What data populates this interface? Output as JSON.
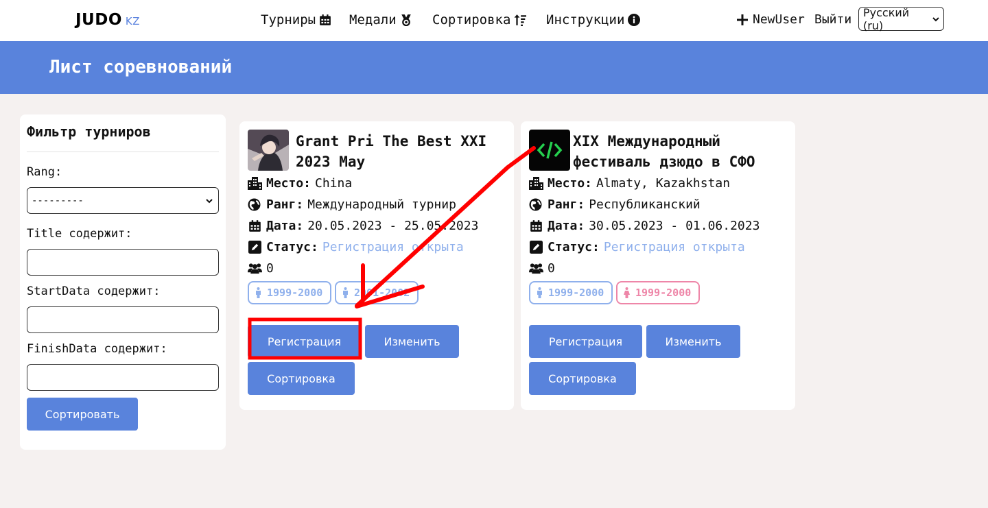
{
  "navbar": {
    "logo": "JUDO",
    "logo_suffix": "KZ",
    "links": [
      {
        "label": "Турниры",
        "icon": "calendar-icon"
      },
      {
        "label": "Медали",
        "icon": "medal-icon"
      },
      {
        "label": "Сортировка",
        "icon": "sort-icon"
      },
      {
        "label": "Инструкции",
        "icon": "info-icon"
      }
    ],
    "user": "NewUser",
    "logout": "Выйти",
    "language": "Русский (ru)"
  },
  "banner": {
    "title": "Лист соревнований"
  },
  "filter": {
    "title": "Фильтр турниров",
    "rang_label": "Rang:",
    "rang_value": "---------",
    "title_label": "Title содержит:",
    "start_label": "StartData содержит:",
    "finish_label": "FinishData содержит:",
    "submit": "Сортировать"
  },
  "labels": {
    "place": "Место:",
    "rank": "Ранг:",
    "date": "Дата:",
    "status": "Статус:"
  },
  "tournaments": [
    {
      "title": "Grant Pri The Best XXI 2023 May",
      "place": "China",
      "rank": "Международный турнир",
      "date": "20.05.2023 - 25.05.2023",
      "status": "Регистрация открыта",
      "participants": "0",
      "categories": [
        {
          "gender": "male",
          "years": "1999-2000"
        },
        {
          "gender": "male",
          "years": "2001-2002"
        }
      ],
      "buttons": {
        "register": "Регистрация",
        "edit": "Изменить",
        "sort": "Сортировка"
      }
    },
    {
      "title": "XIX Международный фестиваль дзюдо в СФО",
      "place": "Almaty, Kazakhstan",
      "rank": "Республиканский",
      "date": "30.05.2023 - 01.06.2023",
      "status": "Регистрация открыта",
      "participants": "0",
      "categories": [
        {
          "gender": "male",
          "years": "1999-2000"
        },
        {
          "gender": "female",
          "years": "1999-2000"
        }
      ],
      "buttons": {
        "register": "Регистрация",
        "edit": "Изменить",
        "sort": "Сортировка"
      }
    }
  ],
  "colors": {
    "primary": "#5983dc",
    "status": "#8fb0ec",
    "female": "#ee86a8",
    "annotation": "#ff0000"
  }
}
